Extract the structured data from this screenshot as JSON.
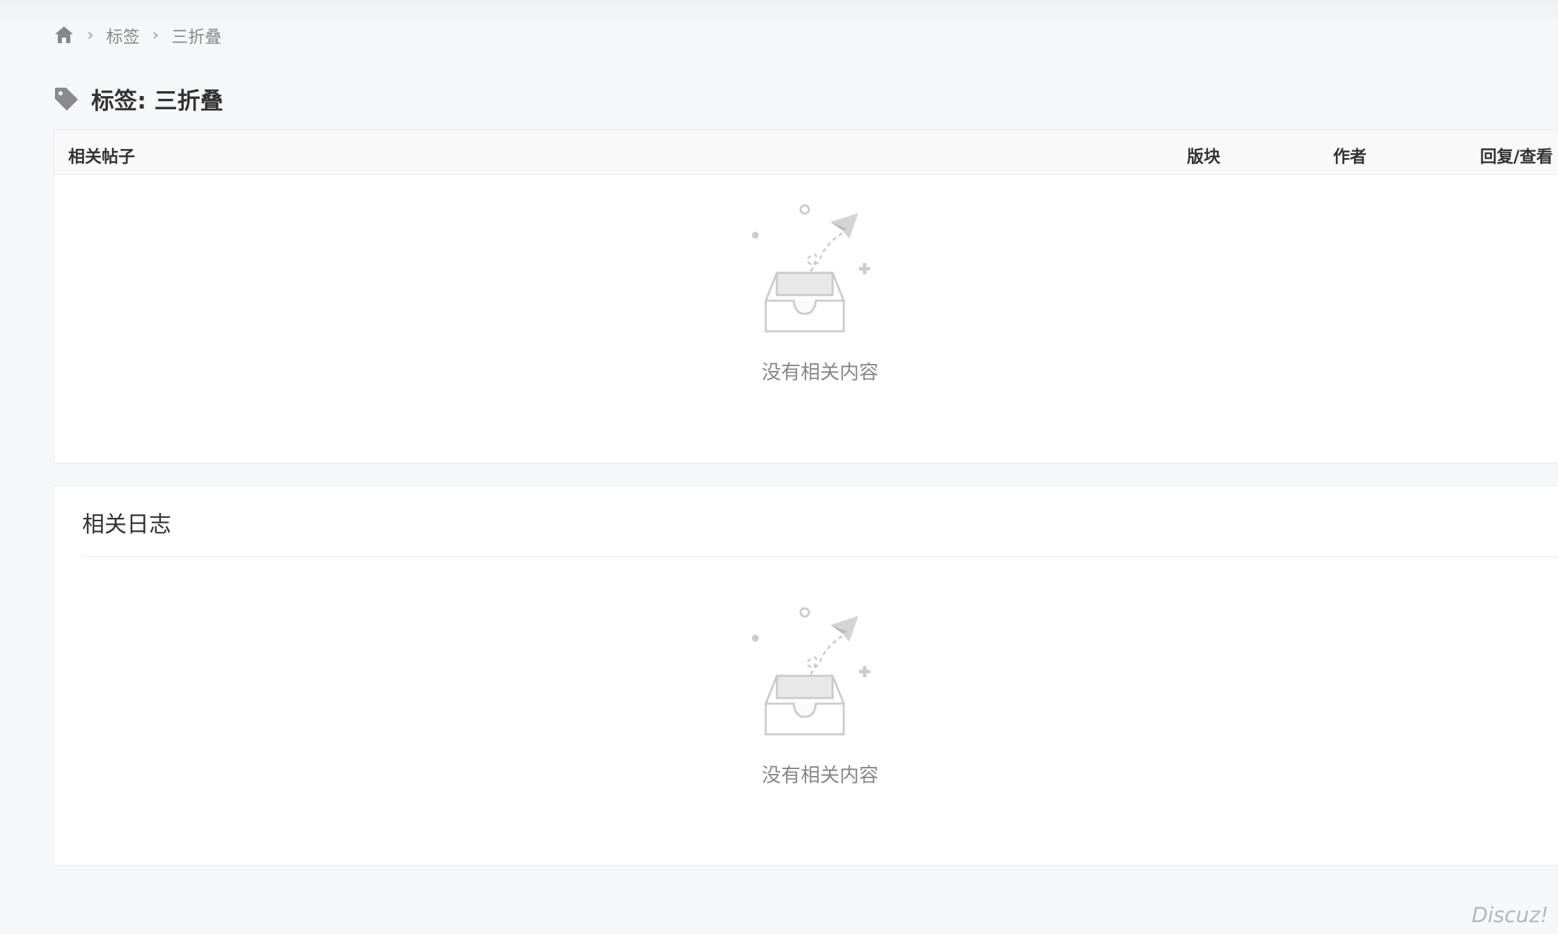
{
  "breadcrumb": {
    "home_icon": "home-icon",
    "items": [
      "标签",
      "三折叠"
    ],
    "separator": "›"
  },
  "page_title": "标签: 三折叠",
  "threads_table": {
    "columns": [
      "相关帖子",
      "版块",
      "作者",
      "回复/查看"
    ],
    "empty_text": "没有相关内容"
  },
  "logs_section": {
    "title": "相关日志",
    "empty_text": "没有相关内容"
  },
  "watermark": "Discuz!",
  "colors": {
    "background": "#f6f7f9",
    "panel": "#ffffff",
    "border": "#e8e9ec",
    "muted_text": "#888888"
  }
}
